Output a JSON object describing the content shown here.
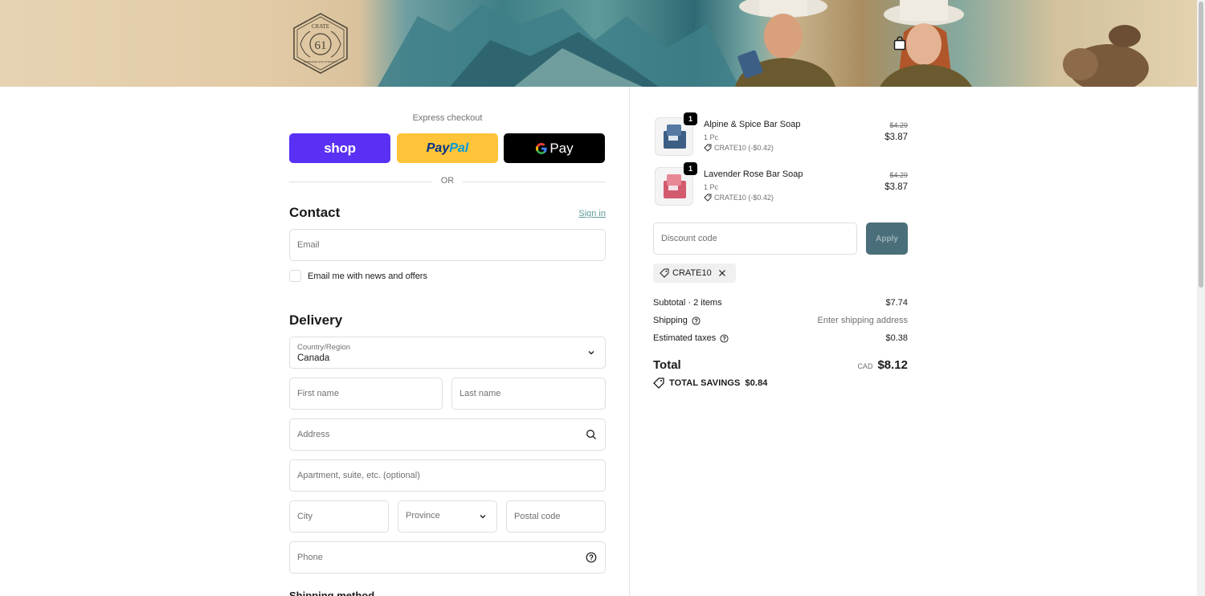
{
  "header": {
    "logo_text_top": "CRATE",
    "logo_number": "61",
    "logo_text_bottom": "HANDMADE WITH INTEGRITY"
  },
  "express": {
    "label": "Express checkout",
    "shop_label": "shop",
    "paypal_label_1": "Pay",
    "paypal_label_2": "Pal",
    "gpay_label": "Pay",
    "or_label": "OR"
  },
  "contact": {
    "title": "Contact",
    "signin_label": "Sign in",
    "email_placeholder": "Email",
    "newsletter_label": "Email me with news and offers"
  },
  "delivery": {
    "title": "Delivery",
    "country_label": "Country/Region",
    "country_value": "Canada",
    "first_name_placeholder": "First name",
    "last_name_placeholder": "Last name",
    "address_placeholder": "Address",
    "apartment_placeholder": "Apartment, suite, etc. (optional)",
    "city_placeholder": "City",
    "province_placeholder": "Province",
    "postal_placeholder": "Postal code",
    "phone_placeholder": "Phone",
    "shipping_method_title": "Shipping method"
  },
  "order": {
    "items": [
      {
        "qty": "1",
        "name": "Alpine & Spice Bar Soap",
        "variant": "1 Pc",
        "discount": "CRATE10 (-$0.42)",
        "old_price": "$4.29",
        "new_price": "$3.87",
        "color": "#3d5f86"
      },
      {
        "qty": "1",
        "name": "Lavender Rose Bar Soap",
        "variant": "1 Pc",
        "discount": "CRATE10 (-$0.42)",
        "old_price": "$4.29",
        "new_price": "$3.87",
        "color": "#d45a6e"
      }
    ],
    "discount_placeholder": "Discount code",
    "apply_label": "Apply",
    "applied_code": "CRATE10",
    "subtotal_label": "Subtotal · 2 items",
    "subtotal_value": "$7.74",
    "shipping_label": "Shipping",
    "shipping_value": "Enter shipping address",
    "taxes_label": "Estimated taxes",
    "taxes_value": "$0.38",
    "total_label": "Total",
    "total_currency": "CAD",
    "total_value": "$8.12",
    "savings_label": "TOTAL SAVINGS",
    "savings_value": "$0.84"
  },
  "colors": {
    "shop_purple": "#5a31f4",
    "paypal_yellow": "#ffc439",
    "accent_teal": "#5f9a9b",
    "apply_button": "#4a6e7a"
  }
}
